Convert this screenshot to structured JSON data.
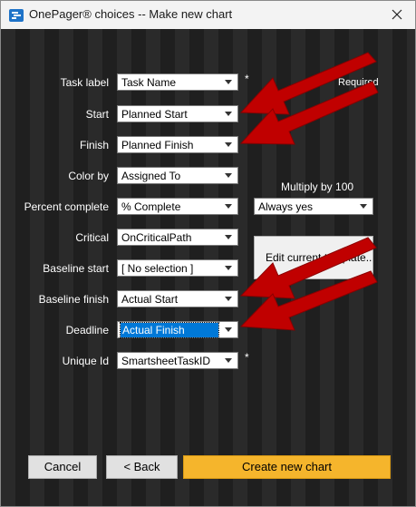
{
  "window": {
    "title": "OnePager® choices -- Make new chart",
    "icon": "onepager-app-icon",
    "close_icon": "close-icon"
  },
  "required_note": "Required",
  "fields": [
    {
      "label": "Task label",
      "value": "Task Name",
      "required_mark": "*"
    },
    {
      "label": "Start",
      "value": "Planned Start"
    },
    {
      "label": "Finish",
      "value": "Planned Finish"
    },
    {
      "label": "Color by",
      "value": "Assigned To"
    },
    {
      "label": "Percent complete",
      "value": "% Complete"
    },
    {
      "label": "Critical",
      "value": "OnCriticalPath"
    },
    {
      "label": "Baseline start",
      "value": "[ No selection ]"
    },
    {
      "label": "Baseline finish",
      "value": "Actual Start"
    },
    {
      "label": "Deadline",
      "value": "Actual Finish",
      "focused": true
    },
    {
      "label": "Unique Id",
      "value": "SmartsheetTaskID",
      "required_mark": "*"
    }
  ],
  "multiply": {
    "label": "Multiply by 100",
    "value": "Always yes"
  },
  "edit_template_button": "Edit current template...",
  "buttons": {
    "cancel": "Cancel",
    "back": "< Back",
    "create": "Create new chart"
  },
  "colors": {
    "create_button": "#f5b52c",
    "annotation_arrow": "#c00000",
    "selection_highlight": "#0078d7"
  }
}
